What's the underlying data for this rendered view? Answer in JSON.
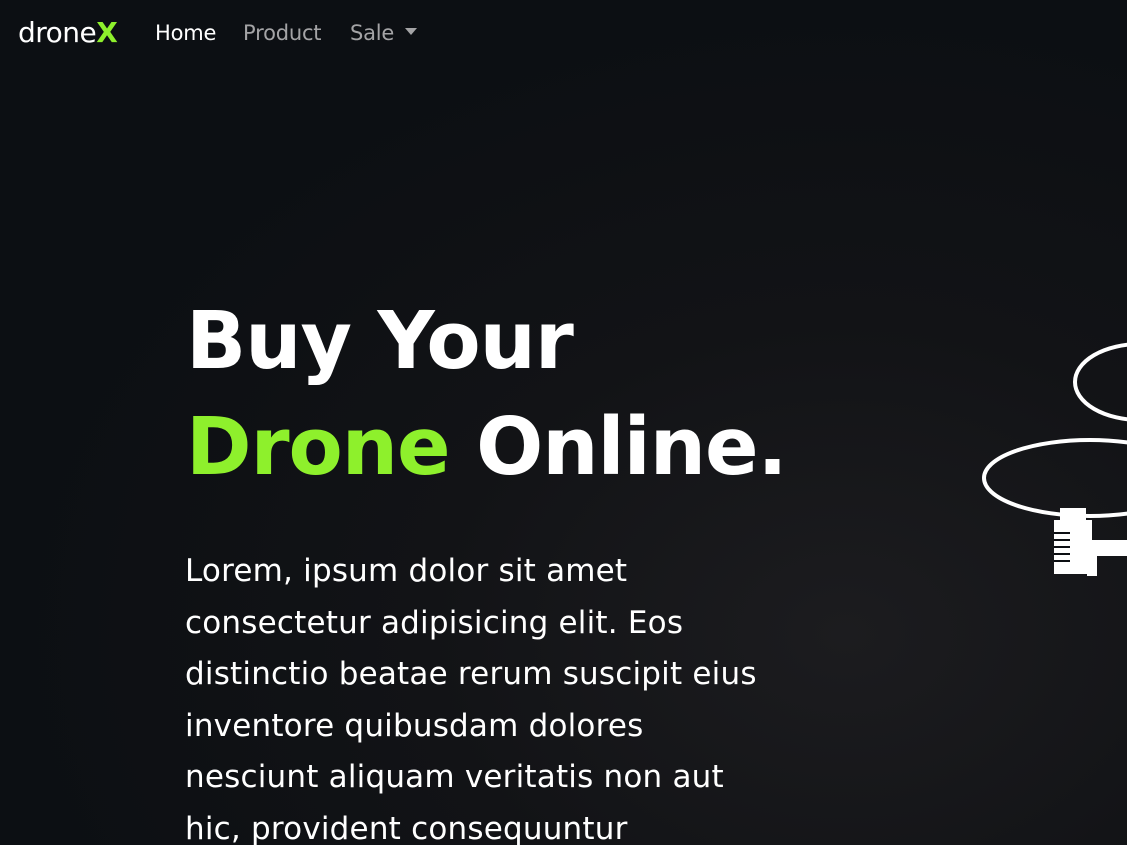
{
  "brand": {
    "name_main": "drone",
    "name_accent": "X"
  },
  "nav": {
    "home": "Home",
    "product": "Product",
    "sale": "Sale"
  },
  "hero": {
    "title_line1": "Buy Your",
    "title_highlight": "Drone",
    "title_rest": " Online.",
    "description": "Lorem, ipsum dolor sit amet consectetur adipisicing elit. Eos distinctio beatae rerum suscipit eius inventore quibusdam dolores nesciunt aliquam veritatis non aut hic, provident consequuntur"
  },
  "colors": {
    "background": "#0c0f13",
    "accent": "#8ef02c",
    "nav_inactive": "#a4a4a6"
  },
  "icons": {
    "dropdown": "chevron-down-icon",
    "hero_image": "drone-image"
  }
}
